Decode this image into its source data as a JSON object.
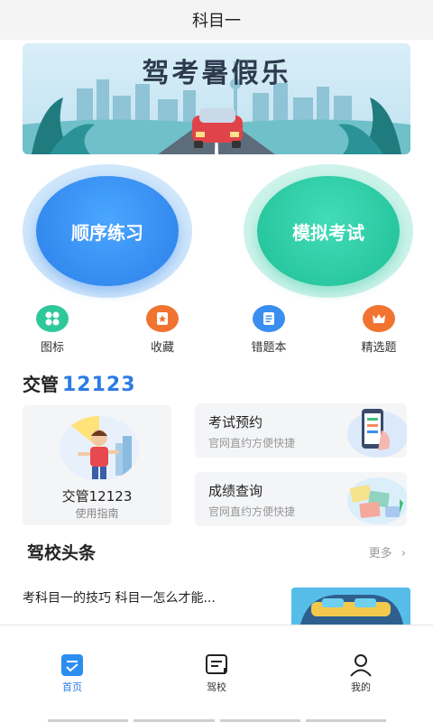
{
  "header": {
    "title": "科目一"
  },
  "banner": {
    "title": "驾考暑假乐"
  },
  "main_buttons": [
    {
      "label": "顺序练习"
    },
    {
      "label": "模拟考试"
    }
  ],
  "quick_items": [
    {
      "label": "图标",
      "icon": "grid-icon",
      "color": "#2fc89b"
    },
    {
      "label": "收藏",
      "icon": "star-icon",
      "color": "#f0742f"
    },
    {
      "label": "错题本",
      "icon": "list-icon",
      "color": "#3a8ef0"
    },
    {
      "label": "精选题",
      "icon": "crown-icon",
      "color": "#f0742f"
    }
  ],
  "jiaoguan": {
    "title_cn": "交管",
    "title_num": "12123",
    "guide_title": "交管12123",
    "guide_sub": "使用指南",
    "services": [
      {
        "title": "考试预约",
        "sub": "官网直约方便快捷"
      },
      {
        "title": "成绩查询",
        "sub": "官网直约方便快捷"
      }
    ]
  },
  "news": {
    "section_title": "驾校头条",
    "more_label": "更多",
    "items": [
      {
        "title": "考科目一的技巧 科目一怎么才能..."
      }
    ]
  },
  "tabbar": [
    {
      "label": "首页",
      "icon": "home-check-icon",
      "active": true
    },
    {
      "label": "驾校",
      "icon": "school-icon",
      "active": false
    },
    {
      "label": "我的",
      "icon": "user-icon",
      "active": false
    }
  ],
  "colors": {
    "accent_blue": "#2c7be5",
    "accent_green": "#1fbf97",
    "accent_orange": "#f0742f"
  }
}
